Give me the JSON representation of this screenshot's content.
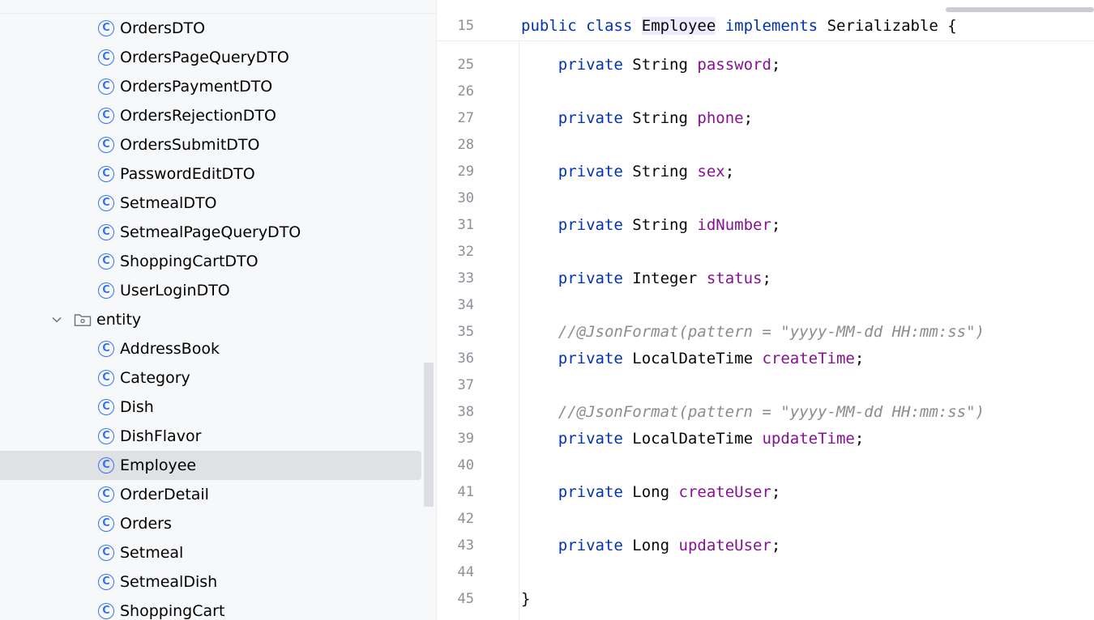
{
  "project_tree": {
    "items_before": [
      "OrdersDTO",
      "OrdersPageQueryDTO",
      "OrdersPaymentDTO",
      "OrdersRejectionDTO",
      "OrdersSubmitDTO",
      "PasswordEditDTO",
      "SetmealDTO",
      "SetmealPageQueryDTO",
      "ShoppingCartDTO",
      "UserLoginDTO"
    ],
    "folder": {
      "name": "entity",
      "expanded": true
    },
    "items_after": [
      "AddressBook",
      "Category",
      "Dish",
      "DishFlavor",
      "Employee",
      "OrderDetail",
      "Orders",
      "Setmeal",
      "SetmealDish",
      "ShoppingCart"
    ],
    "selected": "Employee",
    "class_icon_glyph": "C",
    "icons": {
      "class": "class-icon",
      "folder": "package-folder-icon",
      "chevron": "chevron-down-icon"
    }
  },
  "editor": {
    "sticky_header": {
      "line": "15",
      "public_kw": "public",
      "class_kw": "class",
      "class_name": "Employee",
      "implements_kw": "implements",
      "interface": "Serializable",
      "brace": "{"
    },
    "lines": [
      {
        "n": "25",
        "kind": "field",
        "kw": "private",
        "type": "String",
        "name": "password"
      },
      {
        "n": "26",
        "kind": "blank"
      },
      {
        "n": "27",
        "kind": "field",
        "kw": "private",
        "type": "String",
        "name": "phone"
      },
      {
        "n": "28",
        "kind": "blank"
      },
      {
        "n": "29",
        "kind": "field",
        "kw": "private",
        "type": "String",
        "name": "sex"
      },
      {
        "n": "30",
        "kind": "blank"
      },
      {
        "n": "31",
        "kind": "field",
        "kw": "private",
        "type": "String",
        "name": "idNumber"
      },
      {
        "n": "32",
        "kind": "blank"
      },
      {
        "n": "33",
        "kind": "field",
        "kw": "private",
        "type": "Integer",
        "name": "status"
      },
      {
        "n": "34",
        "kind": "blank"
      },
      {
        "n": "35",
        "kind": "comment",
        "text": "//@JsonFormat(pattern = \"yyyy-MM-dd HH:mm:ss\")"
      },
      {
        "n": "36",
        "kind": "field",
        "kw": "private",
        "type": "LocalDateTime",
        "name": "createTime"
      },
      {
        "n": "37",
        "kind": "blank"
      },
      {
        "n": "38",
        "kind": "comment",
        "text": "//@JsonFormat(pattern = \"yyyy-MM-dd HH:mm:ss\")"
      },
      {
        "n": "39",
        "kind": "field",
        "kw": "private",
        "type": "LocalDateTime",
        "name": "updateTime"
      },
      {
        "n": "40",
        "kind": "blank"
      },
      {
        "n": "41",
        "kind": "field",
        "kw": "private",
        "type": "Long",
        "name": "createUser"
      },
      {
        "n": "42",
        "kind": "blank"
      },
      {
        "n": "43",
        "kind": "field",
        "kw": "private",
        "type": "Long",
        "name": "updateUser"
      },
      {
        "n": "44",
        "kind": "blank"
      },
      {
        "n": "45",
        "kind": "close",
        "text": "}"
      }
    ],
    "semicolon": ";"
  },
  "colors": {
    "keyword": "#0033b3",
    "field": "#871094",
    "comment": "#8c8c8c",
    "line_number": "#8c8f99",
    "selection": "#dfe1e5",
    "class_icon": "#3574f0",
    "class_name_highlight": "#edebfc"
  }
}
